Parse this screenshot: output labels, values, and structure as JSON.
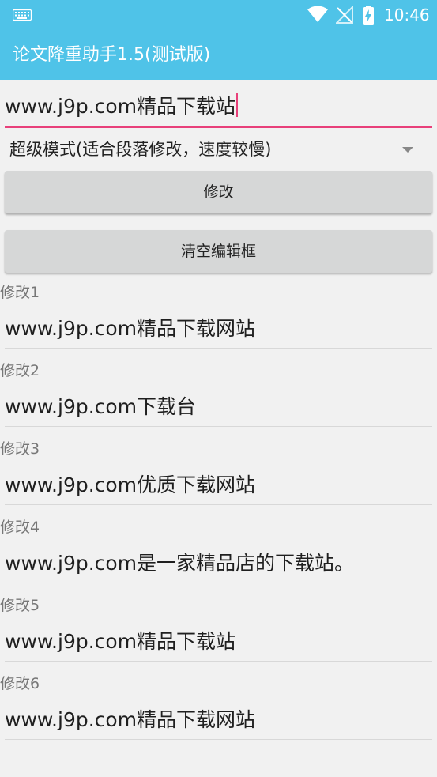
{
  "status_bar": {
    "time": "10:46",
    "icons": [
      "keyboard-icon",
      "wifi-icon",
      "no-signal-icon",
      "battery-charging-icon"
    ]
  },
  "app_bar": {
    "title": "论文降重助手1.5(测试版)"
  },
  "input": {
    "value": "www.j9p.com精品下载站"
  },
  "mode_spinner": {
    "selected": "超级模式(适合段落修改，速度较慢)"
  },
  "buttons": {
    "modify_label": "修改",
    "clear_label": "清空编辑框"
  },
  "results": [
    {
      "label": "修改1",
      "value": "www.j9p.com精品下载网站"
    },
    {
      "label": "修改2",
      "value": "www.j9p.com下载台"
    },
    {
      "label": "修改3",
      "value": "www.j9p.com优质下载网站"
    },
    {
      "label": "修改4",
      "value": "www.j9p.com是一家精品店的下载站。"
    },
    {
      "label": "修改5",
      "value": "www.j9p.com精品下载站"
    },
    {
      "label": "修改6",
      "value": "www.j9p.com精品下载网站"
    }
  ],
  "colors": {
    "app_bar": "#4fc3e8",
    "accent": "#e8407a",
    "button": "#d6d7d7",
    "background": "#f1f1f1"
  }
}
